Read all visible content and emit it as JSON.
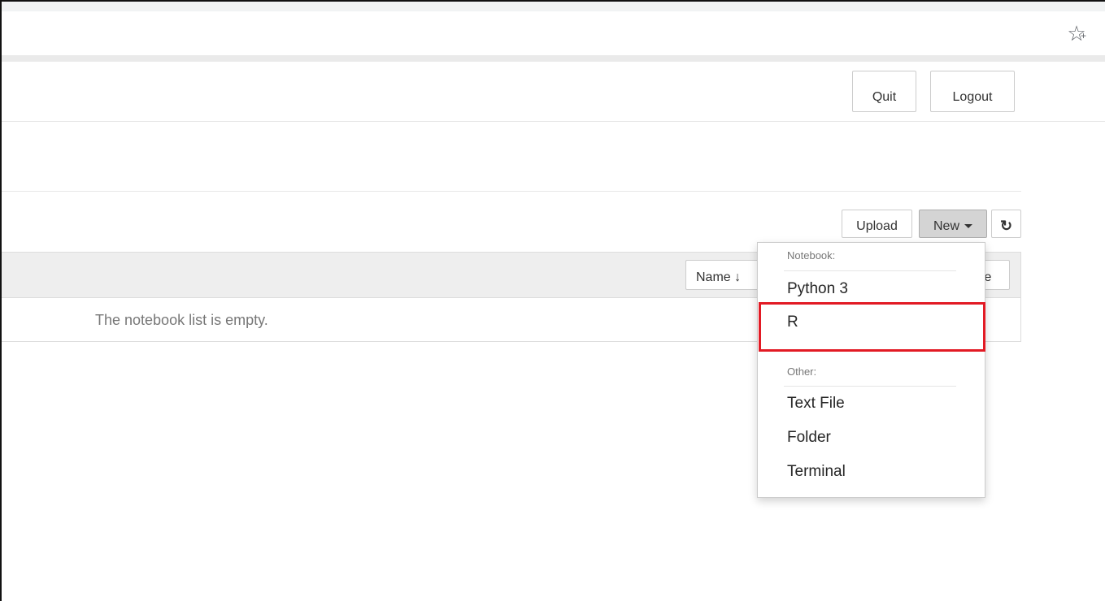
{
  "browser": {
    "bookmark_icon": "star-plus-icon"
  },
  "header": {
    "quit_label": "Quit",
    "logout_label": "Logout"
  },
  "toolbar": {
    "upload_label": "Upload",
    "new_label": "New",
    "new_icon": "caret-down-icon",
    "refresh_icon": "refresh-icon",
    "refresh_glyph": "↻"
  },
  "list": {
    "sort_name_label": "Name ↓",
    "sort_size_label": "ze",
    "empty_message": "The notebook list is empty."
  },
  "new_menu": {
    "notebook_header": "Notebook:",
    "notebook_items": [
      "Python 3",
      "R"
    ],
    "other_header": "Other:",
    "other_items": [
      "Text File",
      "Folder",
      "Terminal"
    ],
    "highlighted_item": "R",
    "highlight_color": "#e21a24"
  }
}
